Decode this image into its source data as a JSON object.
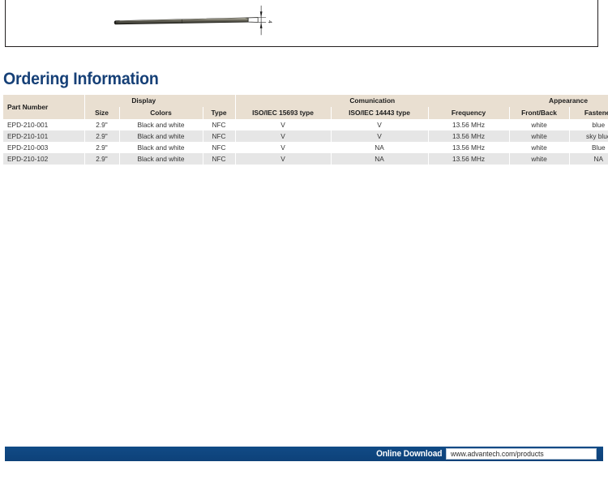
{
  "drawing": {
    "caption_dimension": "4",
    "alt": "side-profile technical drawing of thin EPD tablet with thickness dimension callout"
  },
  "section": {
    "title": "Ordering Information"
  },
  "table": {
    "group_headers": [
      {
        "label": "Part Number",
        "span": 1
      },
      {
        "label": "Display",
        "span": 2
      },
      {
        "label": "",
        "span": 1
      },
      {
        "label": "Comunication",
        "span": 3
      },
      {
        "label": "Appearance",
        "span": 2
      }
    ],
    "columns": [
      "Part Number",
      "Size",
      "Colors",
      "Type",
      "ISO/IEC 15693 type",
      "ISO/IEC 14443 type",
      "Frequency",
      "Front/Back",
      "Fastener"
    ],
    "rows": [
      {
        "part_number": "EPD-210-001",
        "size": "2.9\"",
        "colors": "Black and white",
        "type": "NFC",
        "iso15693": "V",
        "iso14443": "V",
        "frequency": "13.56 MHz",
        "front_back": "white",
        "fastener": "blue"
      },
      {
        "part_number": "EPD-210-101",
        "size": "2.9\"",
        "colors": "Black and white",
        "type": "NFC",
        "iso15693": "V",
        "iso14443": "V",
        "frequency": "13.56 MHz",
        "front_back": "white",
        "fastener": "sky blue"
      },
      {
        "part_number": "EPD-210-003",
        "size": "2.9\"",
        "colors": "Black and white",
        "type": "NFC",
        "iso15693": "V",
        "iso14443": "NA",
        "frequency": "13.56 MHz",
        "front_back": "white",
        "fastener": "Blue"
      },
      {
        "part_number": "EPD-210-102",
        "size": "2.9\"",
        "colors": "Black and white",
        "type": "NFC",
        "iso15693": "V",
        "iso14443": "NA",
        "frequency": "13.56 MHz",
        "front_back": "white",
        "fastener": "NA"
      }
    ]
  },
  "footer": {
    "label": "Online Download",
    "url": "www.advantech.com/products"
  },
  "colors": {
    "title_blue": "#164077",
    "footer_blue": "#0e4a85",
    "header_beige": "#e9dfd1",
    "row_stripe": "#e6e6e6"
  }
}
